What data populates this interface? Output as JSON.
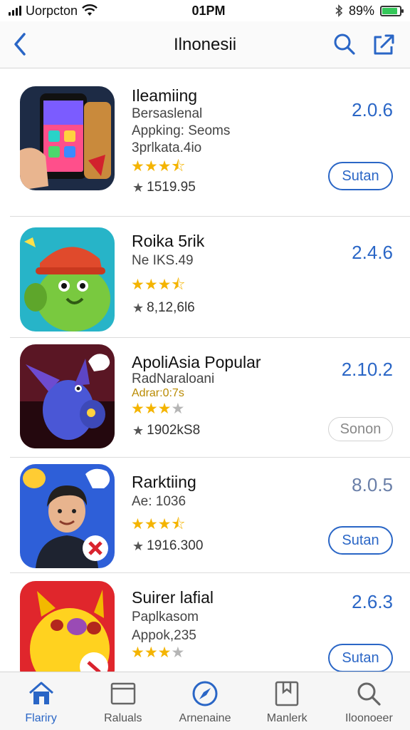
{
  "status_bar": {
    "carrier": "Uorpcton",
    "time": "01PM",
    "battery": "89%",
    "battery_level": 0.89
  },
  "nav": {
    "title": "Ilnonesii",
    "back_icon": "chevron-left-icon",
    "search_icon": "search-icon",
    "share_icon": "share-icon"
  },
  "colors": {
    "accent": "#2a66c6",
    "star": "#f4b400"
  },
  "apps": [
    {
      "name": "Ileamiing",
      "subtitle_lines": [
        "Bersaslenal",
        "Appking: Seoms",
        "3prlkata.4io"
      ],
      "rating": 3.5,
      "count": "1519.95",
      "version": "2.0.6",
      "button": "Sutan"
    },
    {
      "name": "Roika 5rik",
      "subtitle_lines": [
        "Ne IKS.49"
      ],
      "rating": 3.5,
      "count": "8,12,6l6",
      "version": "2.4.6",
      "button": ""
    },
    {
      "name": "ApoliAsia Popular",
      "subtitle_lines": [
        "RadNaraloani",
        "Adrar:0:7s"
      ],
      "rating": 3,
      "count": "1902kS8",
      "version": "2.10.2",
      "button": "Sonon"
    },
    {
      "name": "Rarktiing",
      "subtitle_lines": [
        "Ae: 1036"
      ],
      "rating": 3.5,
      "count": "1916.300",
      "version": "8.0.5",
      "button": "Sutan"
    },
    {
      "name": "Suirer lafial",
      "subtitle_lines": [
        "Paplkasom",
        "Appok,235"
      ],
      "rating": 3,
      "count": "",
      "version": "2.6.3",
      "button": "Sutan"
    }
  ],
  "tabs": [
    {
      "label": "Flariry",
      "icon": "home-icon",
      "active": true
    },
    {
      "label": "Raluals",
      "icon": "browser-window-icon",
      "active": false
    },
    {
      "label": "Arnenaine",
      "icon": "compass-icon",
      "active": false
    },
    {
      "label": "Manlerk",
      "icon": "bookmark-icon",
      "active": false
    },
    {
      "label": "Iloonoeer",
      "icon": "search-icon",
      "active": false
    }
  ]
}
